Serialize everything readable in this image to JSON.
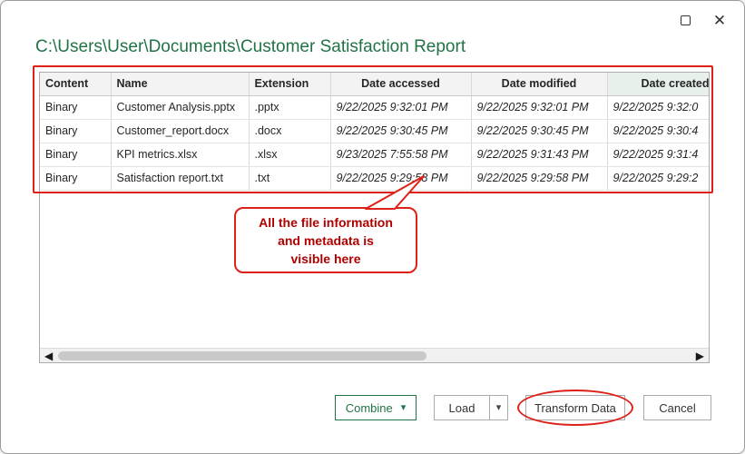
{
  "window": {
    "title": "C:\\Users\\User\\Documents\\Customer Satisfaction Report"
  },
  "icons": {
    "maximize": "square-outline",
    "close": "✕",
    "scroll_left": "◀",
    "scroll_right": "▶",
    "dropdown_caret": "▾"
  },
  "file_table": {
    "columns": [
      "Content",
      "Name",
      "Extension",
      "Date accessed",
      "Date modified",
      "Date created"
    ],
    "rows": [
      [
        "Binary",
        "Customer Analysis.pptx",
        ".pptx",
        "9/22/2025 9:32:01 PM",
        "9/22/2025 9:32:01 PM",
        "9/22/2025 9:32:0"
      ],
      [
        "Binary",
        "Customer_report.docx",
        ".docx",
        "9/22/2025 9:30:45 PM",
        "9/22/2025 9:30:45 PM",
        "9/22/2025 9:30:4"
      ],
      [
        "Binary",
        "KPI metrics.xlsx",
        ".xlsx",
        "9/23/2025 7:55:58 PM",
        "9/22/2025 9:31:43 PM",
        "9/22/2025 9:31:4"
      ],
      [
        "Binary",
        "Satisfaction report.txt",
        ".txt",
        "9/22/2025 9:29:58 PM",
        "9/22/2025 9:29:58 PM",
        "9/22/2025 9:29:2"
      ]
    ]
  },
  "annotations": {
    "callout": {
      "lines": [
        "All the file information",
        "and metadata is",
        "visible here"
      ]
    }
  },
  "footer": {
    "combine_label": "Combine",
    "load_label": "Load",
    "transform_label": "Transform Data",
    "cancel_label": "Cancel"
  },
  "colors": {
    "title_green": "#217346",
    "annotation_red": "#dd2018",
    "callout_text_red": "#b00000"
  }
}
